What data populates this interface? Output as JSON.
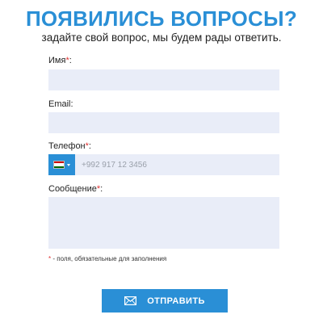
{
  "header": {
    "title": "ПОЯВИЛИСЬ ВОПРОСЫ?",
    "subtitle": "задайте свой вопрос, мы будем рады ответить."
  },
  "form": {
    "name": {
      "label": "Имя",
      "required_mark": "*",
      "suffix": ":",
      "value": ""
    },
    "email": {
      "label": "Email:",
      "value": ""
    },
    "phone": {
      "label": "Телефон",
      "required_mark": "*",
      "suffix": ":",
      "placeholder": "+992 917 12 3456",
      "value": "",
      "country_flag": "tajikistan-flag-icon"
    },
    "message": {
      "label": "Сообщение",
      "required_mark": "*",
      "suffix": ":",
      "value": ""
    },
    "required_note": {
      "mark": "*",
      "text": " - поля, обязательные для заполнения"
    },
    "submit": {
      "label": "ОТПРАВИТЬ",
      "icon": "envelope-icon"
    }
  },
  "colors": {
    "accent": "#2a8fd6",
    "field_background": "#e9edf8",
    "required": "#e03131"
  }
}
